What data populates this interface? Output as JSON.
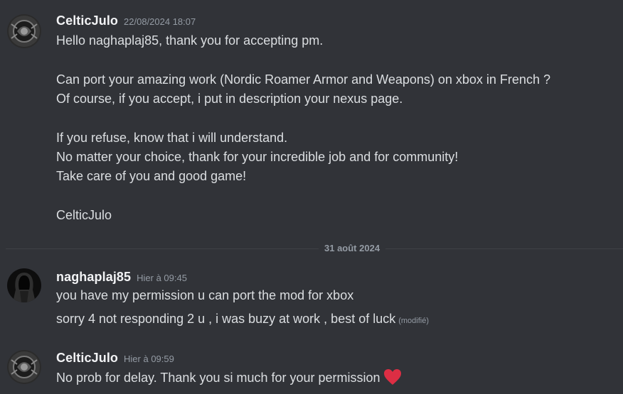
{
  "divider": {
    "label": "31 août 2024"
  },
  "messages": [
    {
      "username": "CelticJulo",
      "timestamp": "22/08/2024 18:07",
      "lines": [
        "Hello naghaplaj85, thank you for accepting pm.",
        "Can port your amazing work (Nordic Roamer Armor and Weapons) on xbox in French ?",
        "Of course, if you accept, i put in description your nexus page.",
        "If you refuse, know that i will understand.",
        "No matter your choice, thank for your incredible job and for community!",
        "Take care of you and good game!",
        "CelticJulo"
      ]
    },
    {
      "username": "naghaplaj85",
      "timestamp": "Hier à 09:45",
      "lines": [
        "you have my permission u can port the mod for xbox",
        "sorry 4 not responding 2  u ,  i was buzy at work , best of luck"
      ],
      "edited_label": "(modifié)"
    },
    {
      "username": "CelticJulo",
      "timestamp": "Hier à 09:59",
      "lines": [
        "No prob for delay. Thank you si much for your permission"
      ],
      "emoji": "heart-icon"
    }
  ],
  "colors": {
    "background": "#313338",
    "username": "#f2f3f5",
    "text": "#dbdee1",
    "muted": "#949ba4",
    "heart": "#dd2e44"
  }
}
